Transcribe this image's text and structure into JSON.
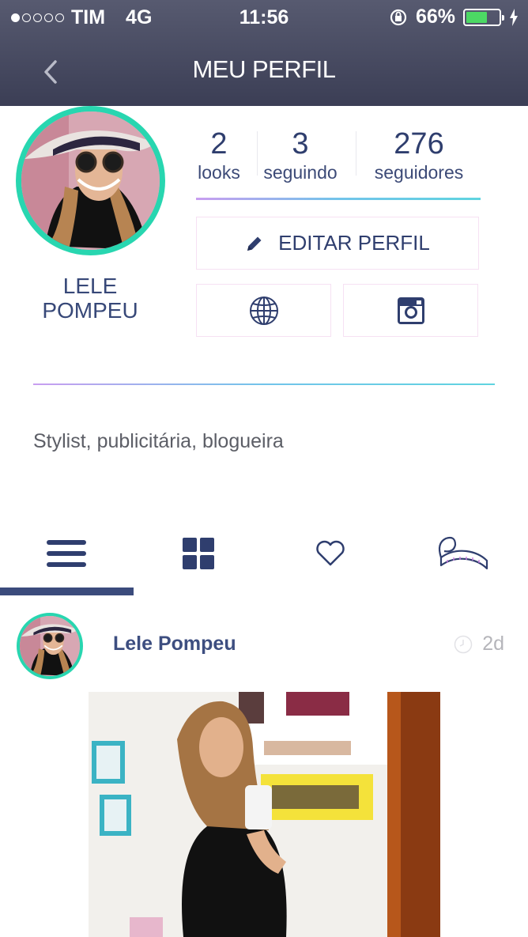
{
  "status_bar": {
    "carrier": "TIM",
    "network": "4G",
    "time": "11:56",
    "battery": "66%",
    "battery_level": 0.66
  },
  "header": {
    "title": "MEU PERFIL"
  },
  "profile": {
    "name_line1": "LELE",
    "name_line2": "POMPEU",
    "stats": [
      {
        "value": "2",
        "label": "looks"
      },
      {
        "value": "3",
        "label": "seguindo"
      },
      {
        "value": "276",
        "label": "seguidores"
      }
    ],
    "edit_button": "EDITAR PERFIL",
    "bio": "Stylist, publicitária, blogueira"
  },
  "tabs": [
    "list-icon",
    "grid-icon",
    "heart-icon",
    "measuring-tape-icon"
  ],
  "post": {
    "user": "Lele Pompeu",
    "time": "2d"
  },
  "colors": {
    "header": "#45485f",
    "accent_ring": "#28d6b0",
    "primary_text": "#2f3e6e",
    "tab_active": "#3b4b7c",
    "battery": "#4cd964"
  }
}
